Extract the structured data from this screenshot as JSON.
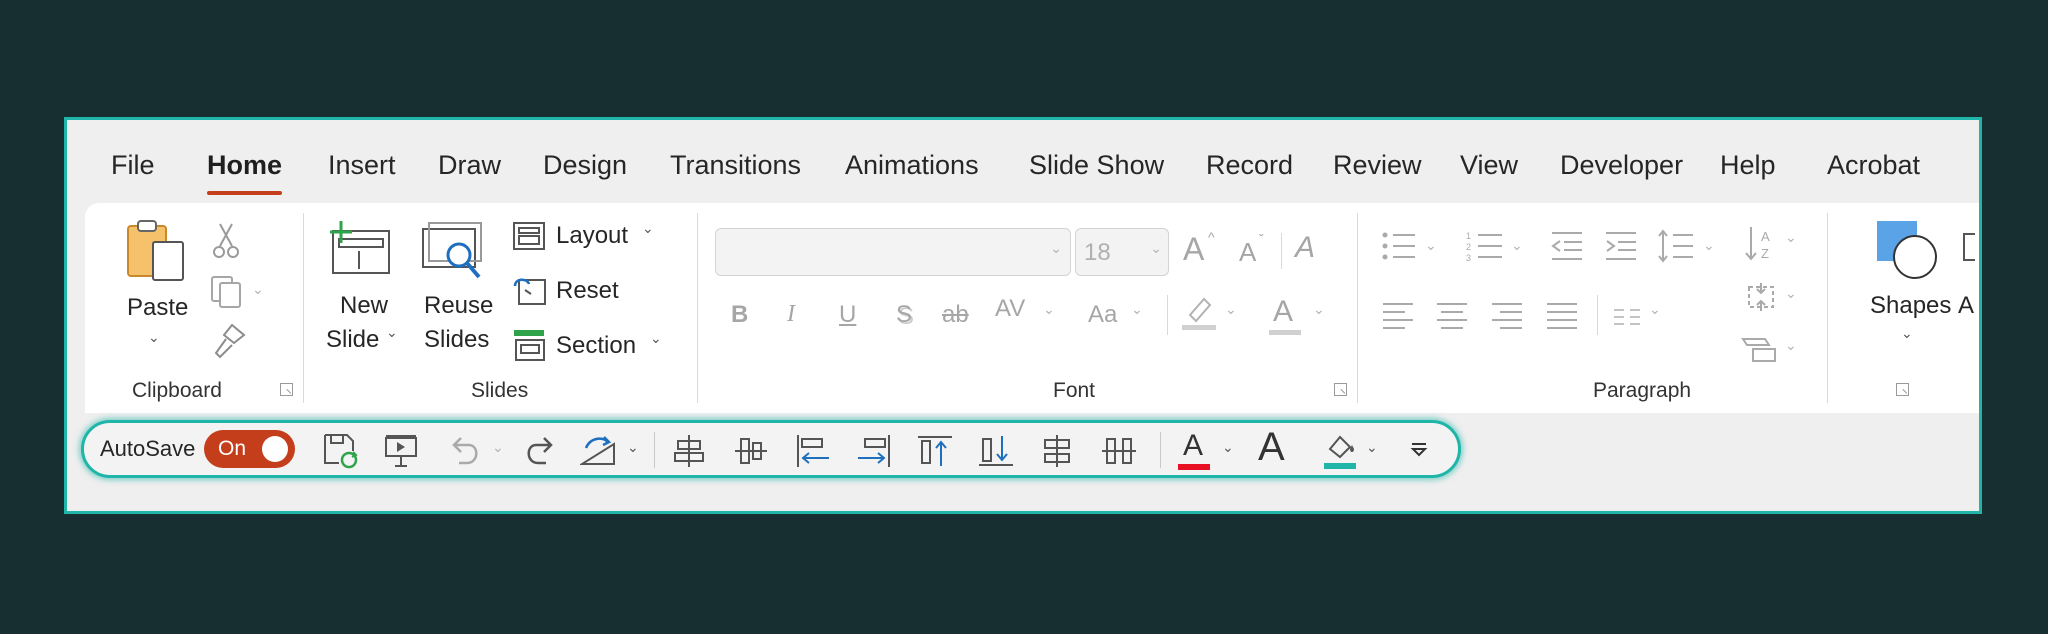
{
  "tabs": [
    "File",
    "Home",
    "Insert",
    "Draw",
    "Design",
    "Transitions",
    "Animations",
    "Slide Show",
    "Record",
    "Review",
    "View",
    "Developer",
    "Help",
    "Acrobat"
  ],
  "active_tab": "Home",
  "clipboard": {
    "paste_label": "Paste",
    "group_label": "Clipboard"
  },
  "slides": {
    "new_slide_line1": "New",
    "new_slide_line2": "Slide",
    "reuse_line1": "Reuse",
    "reuse_line2": "Slides",
    "layout_label": "Layout",
    "reset_label": "Reset",
    "section_label": "Section",
    "group_label": "Slides"
  },
  "font": {
    "font_name_value": "",
    "font_size_value": "18",
    "bold": "B",
    "italic": "I",
    "underline": "U",
    "shadow": "S",
    "strike": "ab",
    "spacing": "AV",
    "change_case": "Aa",
    "grow": "A",
    "shrink": "A",
    "clear": "A",
    "color_a": "A",
    "group_label": "Font"
  },
  "paragraph": {
    "group_label": "Paragraph"
  },
  "drawing": {
    "shapes_label": "Shapes",
    "cut_label": "A"
  },
  "qat": {
    "autosave_label": "AutoSave",
    "toggle_label": "On",
    "font_color_letter": "A",
    "big_a": "A"
  },
  "colors": {
    "accent": "#c43e1c",
    "highlight_frame": "#1fb5a8",
    "font_color_bar": "#e81123",
    "highlight_bar": "#1fb5a8",
    "background": "#182f31"
  }
}
